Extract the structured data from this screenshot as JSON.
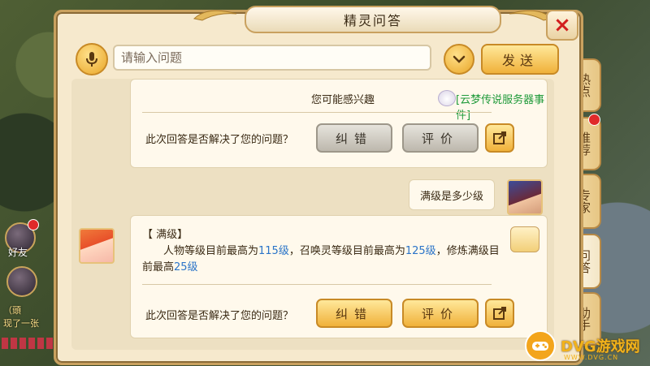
{
  "dialog": {
    "title": "精灵问答",
    "close_label": "×"
  },
  "search": {
    "placeholder": "请输入问题",
    "send_label": "发送"
  },
  "messages": {
    "card1": {
      "interest_prefix": "您可能感兴趣",
      "interest_link": "[云梦传说服务器事件]",
      "resolved_question": "此次回答是否解决了您的问题？",
      "correct_label": "纠错",
      "rate_label": "评价"
    },
    "user_question": "满级是多少级",
    "answer": {
      "title": "【 满级】",
      "part1": "人物等级目前最高为",
      "level1": "115级",
      "part2": "，召唤灵等级目前最高为",
      "level2": "125级",
      "part3": "，修炼满级目前最高",
      "level3": "25级",
      "resolved_question": "此次回答是否解决了您的问题？",
      "correct_label": "纠错",
      "rate_label": "评价"
    }
  },
  "side_tabs": [
    {
      "label": "热点"
    },
    {
      "label": "推荐"
    },
    {
      "label": "专家"
    },
    {
      "label": "问答"
    },
    {
      "label": "助手"
    }
  ],
  "hud": {
    "friends_label": "好友",
    "chat_line1": "（頭",
    "chat_line2": "现了一张"
  },
  "watermark": {
    "brand": "DVG游戏网",
    "url": "WWW.DVG.CN"
  },
  "colors": {
    "highlight": "#2a74c8",
    "link": "#1f9a3a",
    "close_red": "#d21e1e",
    "accent_gold": "#f0b13a"
  }
}
